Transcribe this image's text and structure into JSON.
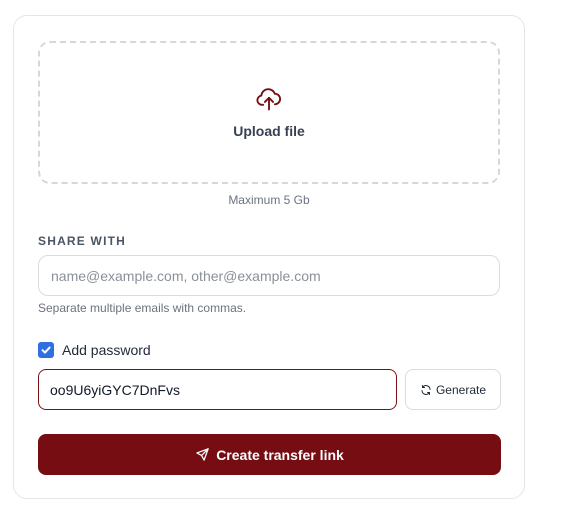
{
  "upload": {
    "label": "Upload file",
    "icon": "cloud-upload-icon",
    "max_size": "Maximum 5 Gb"
  },
  "share": {
    "section_label": "SHARE WITH",
    "email_value": "",
    "email_placeholder": "name@example.com, other@example.com",
    "helper": "Separate multiple emails with commas."
  },
  "password": {
    "checkbox_label": "Add password",
    "checked": true,
    "value": "oo9U6yiGYC7DnFvs",
    "generate_label": "Generate",
    "generate_icon": "refresh-icon"
  },
  "submit": {
    "label": "Create transfer link",
    "icon": "send-icon"
  },
  "colors": {
    "accent": "#760d13",
    "checkbox": "#2f6fdf",
    "border": "#d9dce1"
  }
}
